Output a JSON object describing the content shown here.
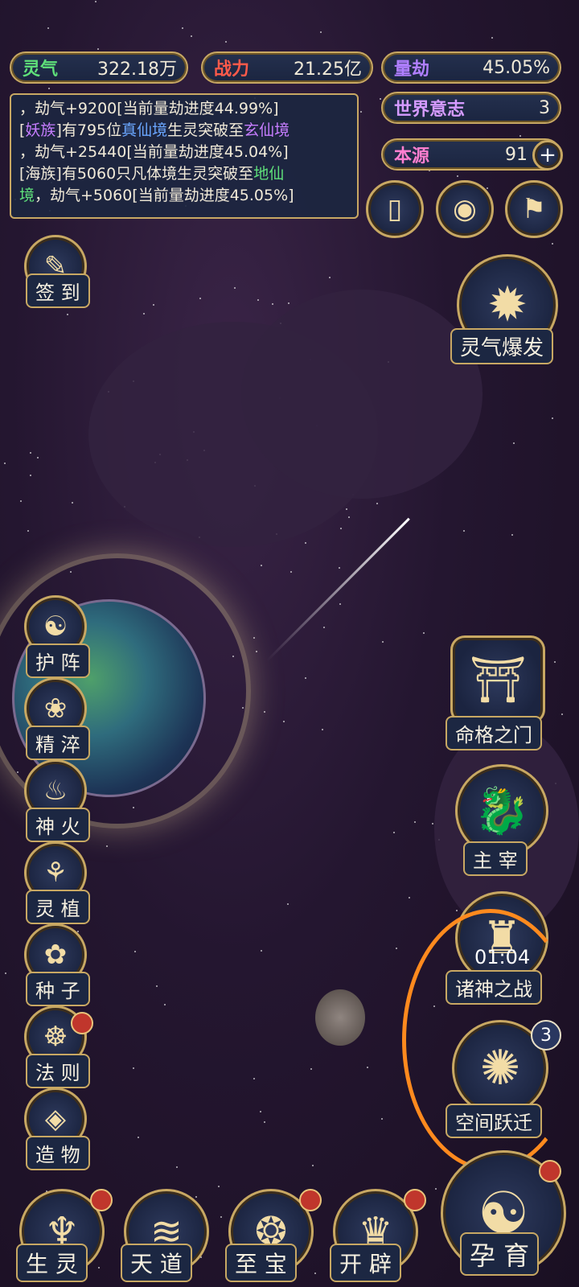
{
  "top_stats": {
    "lingqi": {
      "label": "灵气",
      "value": "322.18万",
      "color": "#5fe07a"
    },
    "zhanli": {
      "label": "战力",
      "value": "21.25亿",
      "color": "#ff5a4a"
    },
    "liangjie": {
      "label": "量劫",
      "value": "45.05%",
      "color": "#b07fff"
    },
    "shijie": {
      "label": "世界意志",
      "value": "3",
      "color": "#d59bff"
    },
    "benyuan": {
      "label": "本源",
      "value": "91",
      "color": "#ff7fd0"
    }
  },
  "log": {
    "line1": "，劫气+9200[当前量劫进度44.99%]",
    "line2_a": "[",
    "line2_race": "妖族",
    "line2_b": "]有795位",
    "line2_realm1": "真仙境",
    "line2_c": "生灵突破至",
    "line2_realm2": "玄仙境",
    "line3": "，劫气+25440[当前量劫进度45.04%]",
    "line4_a": "[海族]有5060只凡体境生灵突破至",
    "line4_realm": "地仙",
    "line5_realm": "境",
    "line5_b": "，劫气+5060[当前量劫进度45.05%]"
  },
  "left_menu": [
    "签 到",
    "护 阵",
    "精 淬",
    "神 火",
    "灵 植",
    "种 子",
    "法 则",
    "造 物"
  ],
  "right_menu": {
    "burst": "灵气爆发",
    "gate": "命格之门",
    "master": "主 宰",
    "war": "诸神之战",
    "war_timer": "01:04",
    "jump": "空间跃迁",
    "jump_count": "3"
  },
  "bottom_nav": [
    "生 灵",
    "天 道",
    "至 宝",
    "开 辟",
    "孕 育"
  ],
  "colors": {
    "gold": "#c8a863",
    "highlight_orange": "#ff8a1e",
    "badge_red": "#c0362c"
  },
  "icons": [
    "scroll-icon",
    "sun-eye-icon",
    "flag-icon",
    "brush-icon",
    "burst-icon",
    "yin-yang-icon",
    "lotus-icon",
    "flame-icon",
    "plant-icon",
    "flower-icon",
    "law-icon",
    "diamond-icon",
    "gate-icon",
    "dragon-icon",
    "tower-icon",
    "vortex-icon",
    "plus-icon"
  ]
}
